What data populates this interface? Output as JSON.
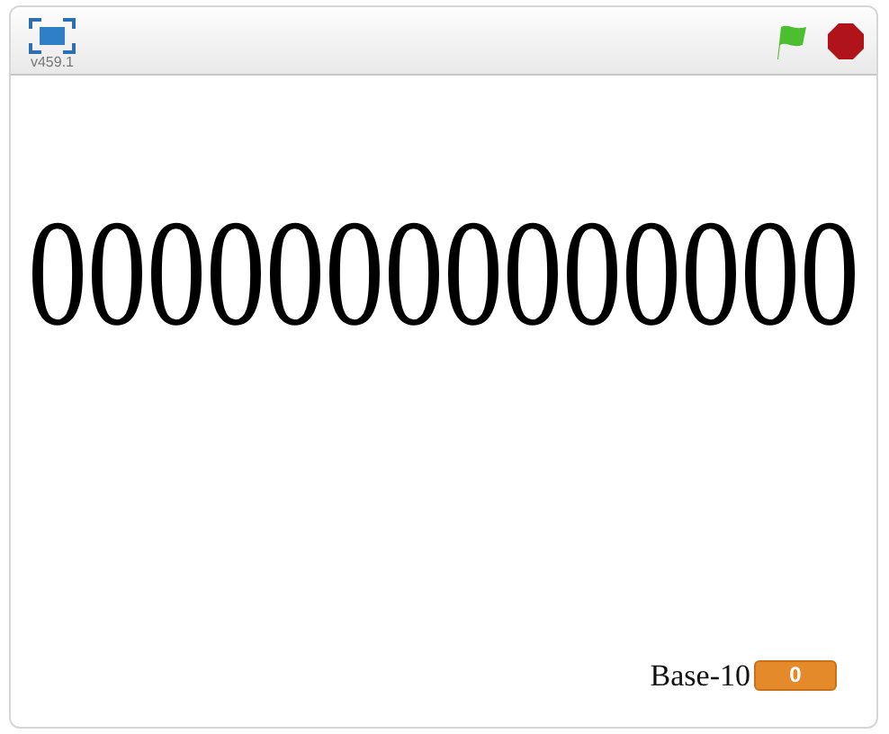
{
  "header": {
    "version": "v459.1"
  },
  "stage": {
    "display": "00000000000000"
  },
  "monitor": {
    "label": "Base-10",
    "value": "0"
  }
}
